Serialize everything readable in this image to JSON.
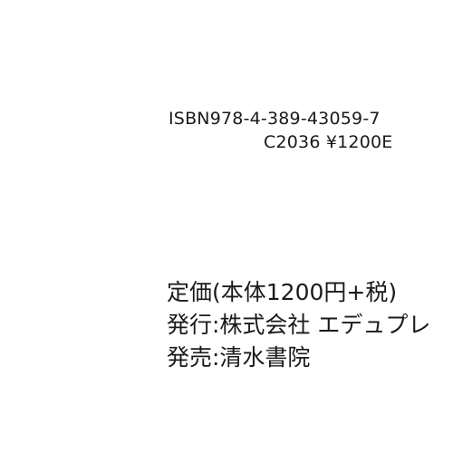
{
  "isbn": {
    "number": "ISBN978-4-389-43059-7",
    "code": "C2036 ¥1200E"
  },
  "colophon": {
    "price": "定価(本体1200円+税)",
    "issuer": "発行:株式会社 エデュプレ",
    "seller": "発売:清水書院"
  }
}
